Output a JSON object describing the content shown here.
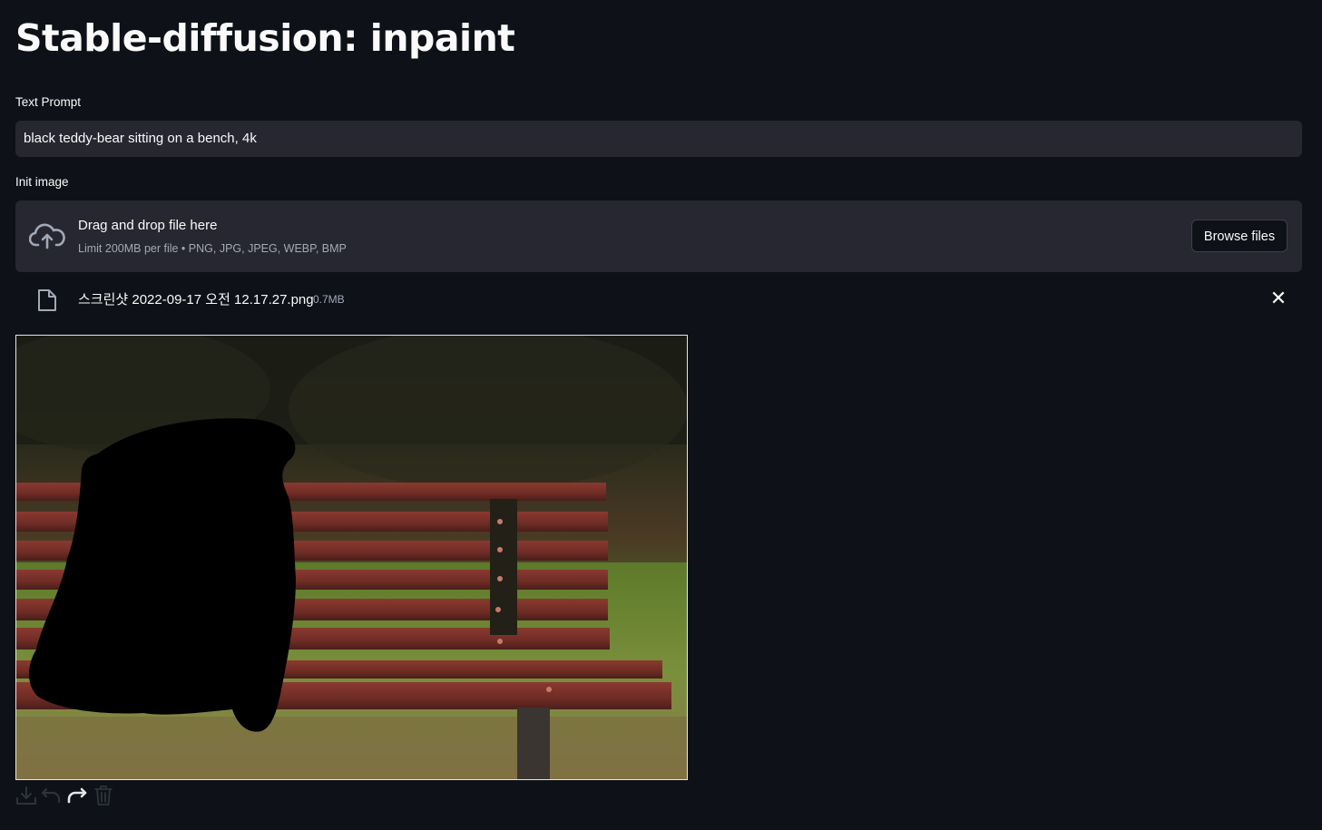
{
  "title": "Stable-diffusion: inpaint",
  "text_prompt": {
    "label": "Text Prompt",
    "value": "black teddy-bear sitting on a bench, 4k"
  },
  "init_image": {
    "label": "Init image",
    "dropzone_title": "Drag and drop file here",
    "dropzone_limit": "Limit 200MB per file • PNG, JPG, JPEG, WEBP, BMP",
    "browse_label": "Browse files",
    "upload_icon": "cloud-upload-icon"
  },
  "uploaded_file": {
    "name": "스크린샷 2022-09-17 오전 12.17.27.png",
    "size": "0.7MB",
    "file_icon": "file-icon",
    "remove_icon": "close-icon",
    "remove_glyph": "✕"
  },
  "canvas_toolbar": {
    "icons": [
      "download-icon",
      "undo-icon",
      "redo-icon",
      "trash-icon"
    ]
  },
  "colors": {
    "background": "#0e1117",
    "widget_bg": "#262730",
    "text": "#fafafa",
    "muted_text": "#a3a8b8",
    "canvas_border": "#e6e6e6"
  }
}
